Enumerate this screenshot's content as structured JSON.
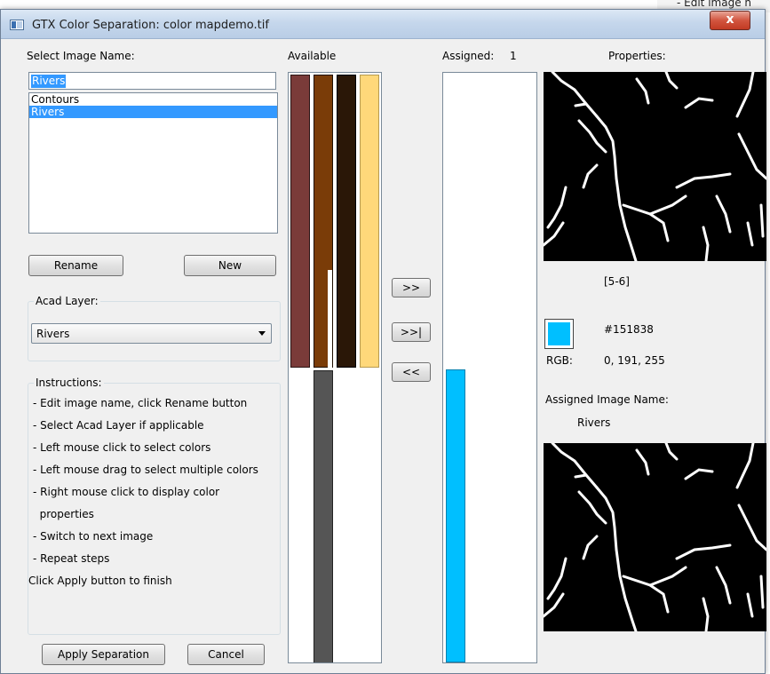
{
  "background": {
    "text": "- Edit image n"
  },
  "window": {
    "title": "GTX Color Separation: color mapdemo.tif",
    "close_label": "x"
  },
  "image_name": {
    "label": "Select Image Name:",
    "value": "Rivers",
    "items": [
      {
        "label": "Contours"
      },
      {
        "label": "Rivers"
      }
    ],
    "selected_index": 1
  },
  "buttons": {
    "rename": "Rename",
    "new": "New",
    "apply": "Apply Separation",
    "cancel": "Cancel",
    "assign": ">>",
    "assign_all": ">>|",
    "remove": "<<"
  },
  "acad_layer": {
    "label": "Acad Layer:",
    "value": "Rivers"
  },
  "instructions": {
    "title": "Instructions:",
    "lines": [
      "- Edit image name, click Rename button",
      "- Select Acad Layer if applicable",
      "- Left mouse click to select colors",
      "- Left mouse drag to select multiple colors",
      "- Right mouse click to display color",
      "  properties",
      "- Switch to next image",
      "- Repeat steps",
      "Click Apply button to finish"
    ]
  },
  "available": {
    "label": "Available",
    "colors": [
      "#7a3b39",
      "#7a3c08",
      "#2a1707",
      "#ffd87a",
      "#555555"
    ]
  },
  "assigned": {
    "label": "Assigned:",
    "count": "1",
    "colors": [
      "#00bfff"
    ]
  },
  "properties": {
    "label": "Properties:",
    "index_range": "[5-6]",
    "hex": "#151838",
    "rgb_label": "RGB:",
    "rgb_value": "0, 191, 255",
    "swatch_color": "#00bfff",
    "assigned_name_label": "Assigned Image Name:",
    "assigned_name": "Rivers"
  }
}
